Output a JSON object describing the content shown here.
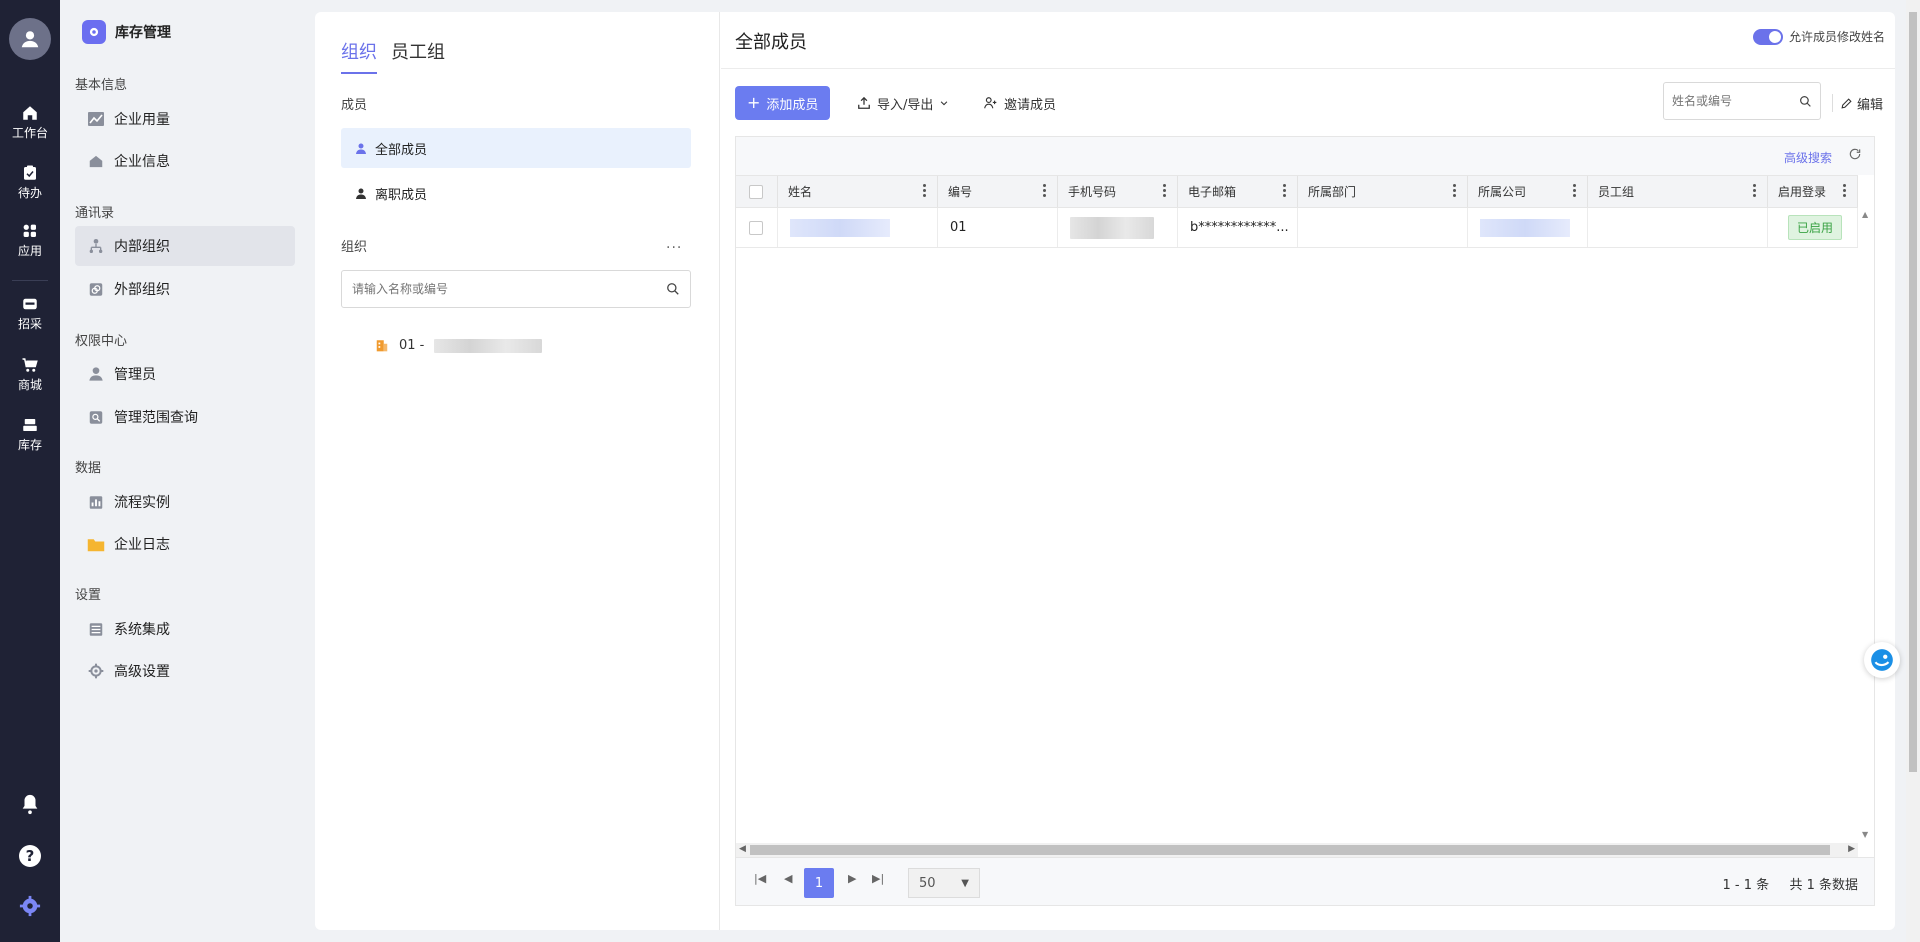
{
  "rail": {
    "items": [
      {
        "label": "工作台",
        "icon": "home-icon"
      },
      {
        "label": "待办",
        "icon": "todo-icon"
      },
      {
        "label": "应用",
        "icon": "apps-icon"
      },
      {
        "label": "招采",
        "icon": "procurement-icon"
      },
      {
        "label": "商城",
        "icon": "cart-icon"
      },
      {
        "label": "库存",
        "icon": "inventory-icon"
      }
    ],
    "bottom_icons": [
      "bell-icon",
      "help-icon",
      "settings-icon"
    ]
  },
  "nav": {
    "app_title": "库存管理",
    "sections": [
      {
        "title": "基本信息",
        "items": [
          {
            "label": "企业用量"
          },
          {
            "label": "企业信息"
          }
        ]
      },
      {
        "title": "通讯录",
        "items": [
          {
            "label": "内部组织"
          },
          {
            "label": "外部组织"
          }
        ]
      },
      {
        "title": "权限中心",
        "items": [
          {
            "label": "管理员"
          },
          {
            "label": "管理范围查询"
          }
        ]
      },
      {
        "title": "数据",
        "items": [
          {
            "label": "流程实例"
          },
          {
            "label": "企业日志"
          }
        ]
      },
      {
        "title": "设置",
        "items": [
          {
            "label": "系统集成"
          },
          {
            "label": "高级设置"
          }
        ]
      }
    ],
    "active": "内部组织"
  },
  "org": {
    "tabs": [
      {
        "label": "组织"
      },
      {
        "label": "员工组"
      }
    ],
    "members_title": "成员",
    "member_items": [
      {
        "label": "全部成员"
      },
      {
        "label": "离职成员"
      }
    ],
    "org_title": "组织",
    "more": "···",
    "search_placeholder": "请输入名称或编号",
    "tree_root": "01 -"
  },
  "main": {
    "title": "全部成员",
    "toggle_label": "允许成员修改姓名",
    "toggle_on": true,
    "add_button": "添加成员",
    "import_export": "导入/导出",
    "invite": "邀请成员",
    "search_placeholder": "姓名或编号",
    "edit": "编辑",
    "advanced_search": "高级搜索"
  },
  "table": {
    "columns": [
      "姓名",
      "编号",
      "手机号码",
      "电子邮箱",
      "所属部门",
      "所属公司",
      "员工组",
      "启用登录"
    ],
    "rows": [
      {
        "name": "",
        "code": "01",
        "phone": "",
        "email": "b************...",
        "dept": "",
        "company": "",
        "group": "",
        "status": "已启用"
      }
    ]
  },
  "pager": {
    "current_page": "1",
    "page_size": "50",
    "range": "1 - 1 条",
    "total": "共 1 条数据"
  },
  "colors": {
    "accent": "#6b72ea",
    "primary_button": "#6b7cf0",
    "rail_bg": "#1f2235",
    "status_green": "#3aa244"
  }
}
